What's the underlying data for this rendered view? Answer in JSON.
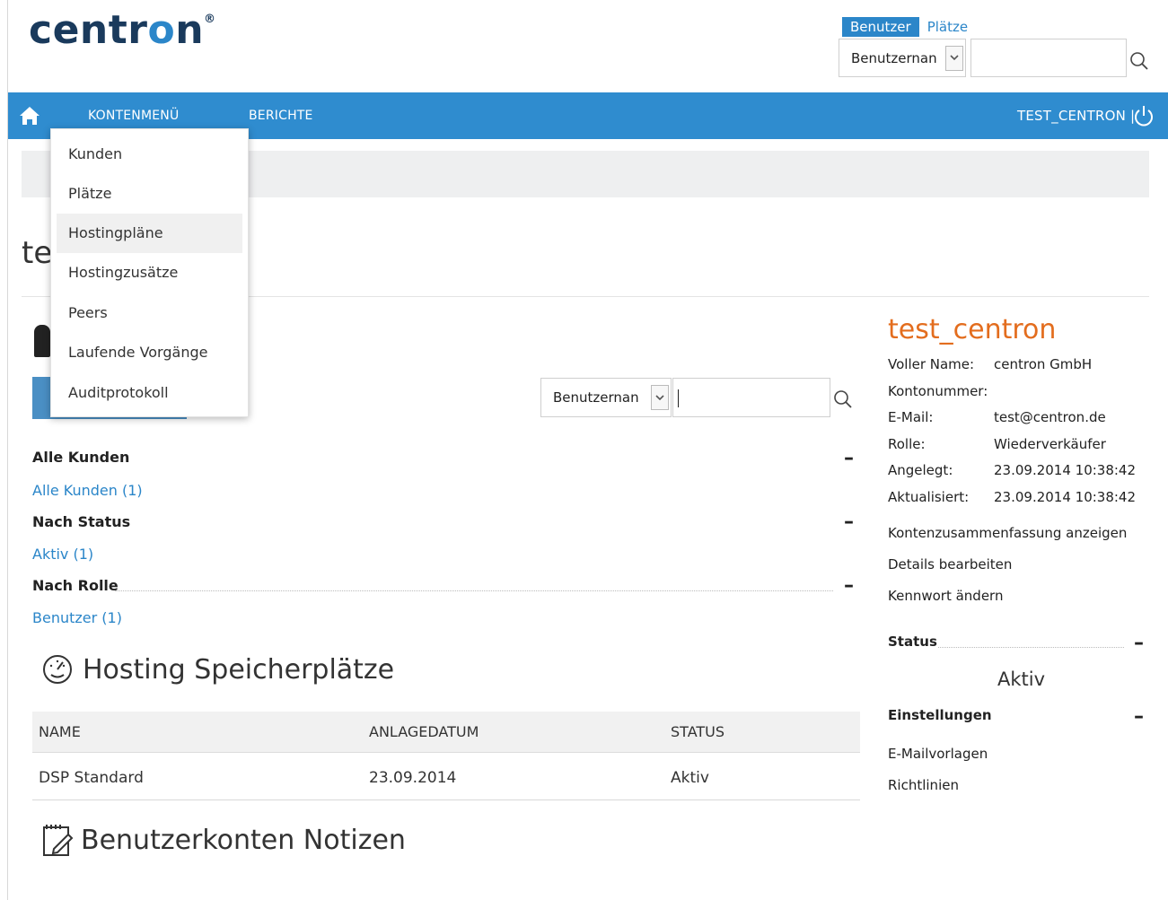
{
  "header": {
    "logo_text": "centron",
    "logo_mark": "®",
    "search_scope": {
      "active": "Benutzer",
      "inactive": "Plätze"
    },
    "search_field_select": "Benutzernan",
    "search_value": ""
  },
  "nav": {
    "home_icon": "home-icon",
    "items": [
      "KONTENMENÜ",
      "BERICHTE"
    ],
    "user": "TEST_CENTRON |",
    "power_icon": "power-icon"
  },
  "dropdown": {
    "items": [
      "Kunden",
      "Plätze",
      "Hostingpläne",
      "Hostingzusätze",
      "Peers",
      "Laufende Vorgänge",
      "Auditprotokoll"
    ],
    "hovered_index": 2
  },
  "page": {
    "title_partial": "te"
  },
  "customer_search": {
    "select": "Benutzernan",
    "value": ""
  },
  "filters": {
    "all": {
      "heading": "Alle Kunden",
      "link": "Alle Kunden (1)"
    },
    "status": {
      "heading": "Nach Status",
      "link": "Aktiv (1)"
    },
    "role": {
      "heading": "Nach Rolle",
      "link": "Benutzer (1)"
    },
    "collapse_symbol": "–"
  },
  "hosting": {
    "title": "Hosting Speicherplätze",
    "columns": [
      "NAME",
      "ANLAGEDATUM",
      "STATUS"
    ],
    "rows": [
      {
        "name": "DSP Standard",
        "date": "23.09.2014",
        "status": "Aktiv"
      }
    ]
  },
  "notes": {
    "title": "Benutzerkonten Notizen"
  },
  "sidebar": {
    "account_name": "test_centron",
    "fields": [
      {
        "label": "Voller Name:",
        "value": "centron GmbH"
      },
      {
        "label": "Kontonummer:",
        "value": ""
      },
      {
        "label": "E-Mail:",
        "value": "test@centron.de"
      },
      {
        "label": "Rolle:",
        "value": "Wiederverkäufer"
      },
      {
        "label": "Angelegt:",
        "value": "23.09.2014 10:38:42"
      },
      {
        "label": "Aktualisiert:",
        "value": "23.09.2014 10:38:42"
      }
    ],
    "actions": [
      "Kontenzusammenfassung anzeigen",
      "Details bearbeiten",
      "Kennwort ändern"
    ],
    "status_heading": "Status",
    "status_value": "Aktiv",
    "settings_heading": "Einstellungen",
    "settings_links": [
      "E-Mailvorlagen",
      "Richtlinien"
    ],
    "collapse_symbol": "–"
  },
  "colors": {
    "brand_dark": "#1a3a5c",
    "accent_blue": "#2f8ccf",
    "link_blue": "#2b86c9",
    "orange": "#e36d1e"
  }
}
